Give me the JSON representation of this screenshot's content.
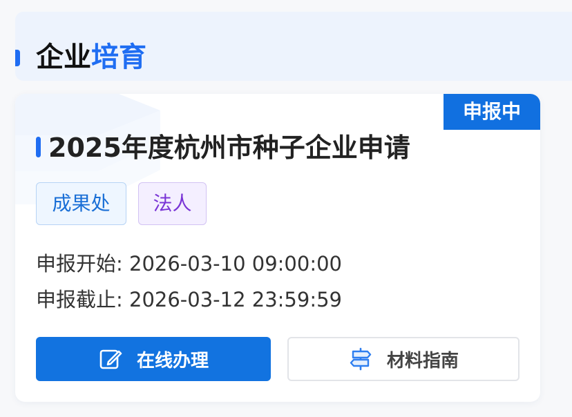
{
  "section": {
    "title_part1": "企业",
    "title_part2": "培育"
  },
  "card": {
    "status": "申报中",
    "title": "2025年度杭州市种子企业申请",
    "tags": [
      "成果处",
      "法人"
    ],
    "start": {
      "label": "申报开始:",
      "value": "2026-03-10 09:00:00"
    },
    "end": {
      "label": "申报截止:",
      "value": "2026-03-12 23:59:59"
    },
    "buttons": {
      "primary": {
        "label": "在线办理",
        "icon": "edit-icon"
      },
      "secondary": {
        "label": "材料指南",
        "icon": "signpost-icon"
      }
    }
  },
  "colors": {
    "accent": "#1f6df2",
    "primary_button": "#1273e0",
    "header_bg": "#edf3fd",
    "tag_blue": "#1a6fd6",
    "tag_purple": "#7a35d6"
  }
}
